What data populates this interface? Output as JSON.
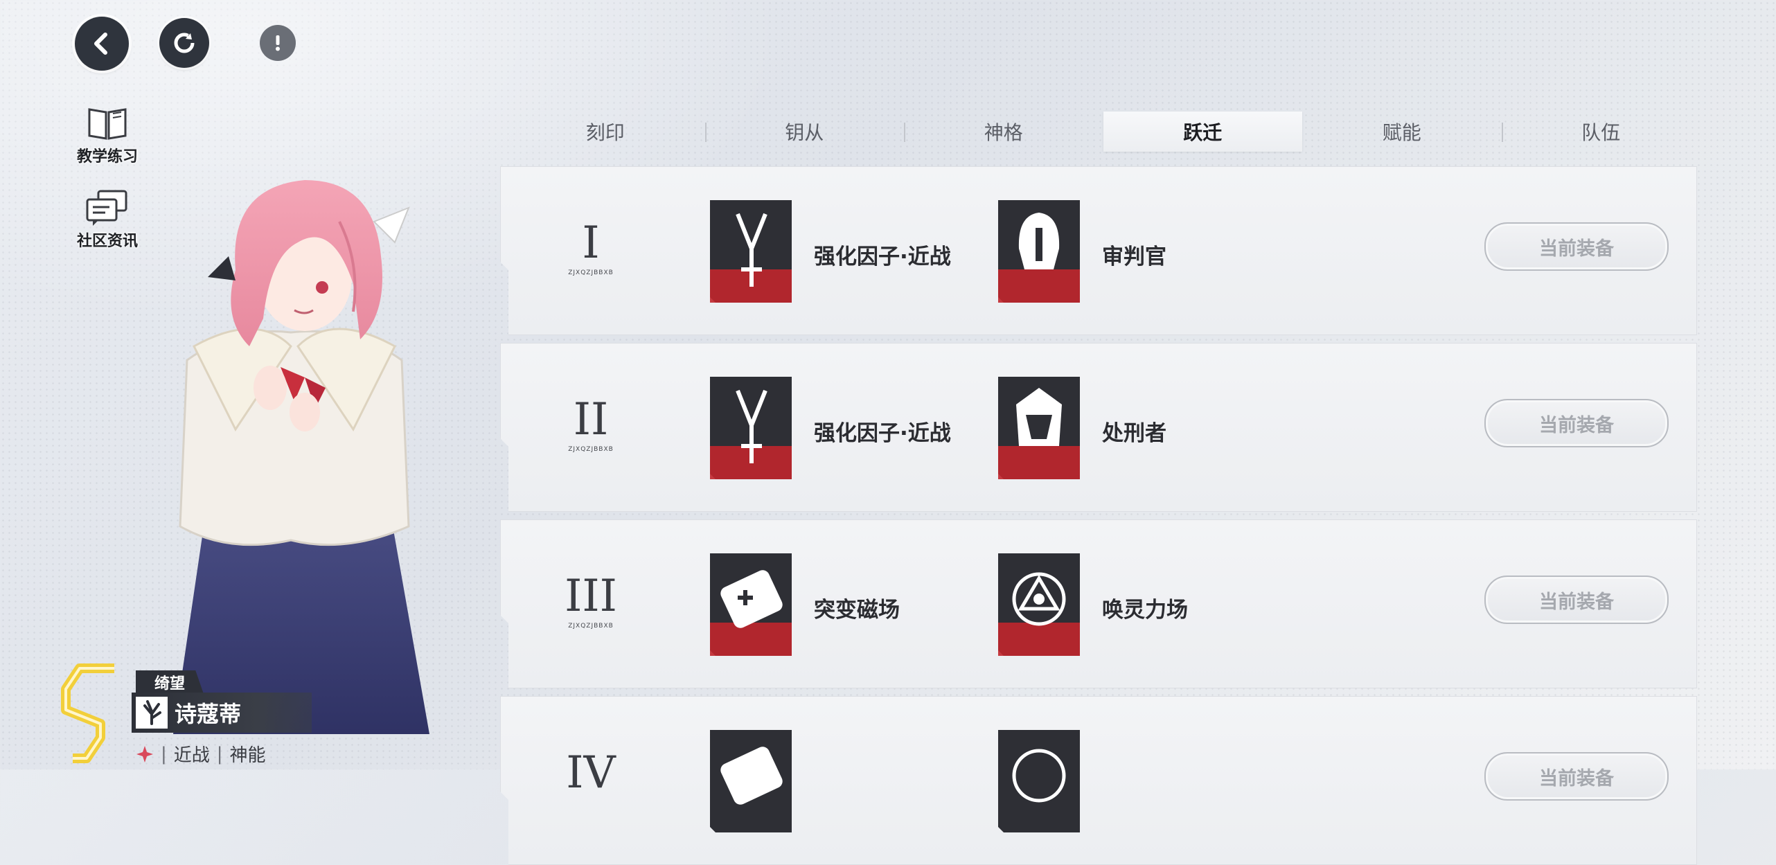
{
  "top_buttons": {
    "back_icon": "chevron-left-icon",
    "sync_icon": "refresh-icon",
    "info_icon": "exclamation-icon"
  },
  "side_links": [
    {
      "label": "教学练习",
      "icon": "book-icon"
    },
    {
      "label": "社区资讯",
      "icon": "chat-icon"
    }
  ],
  "character": {
    "title_tag": "绮望",
    "name": "诗蔻蒂",
    "roles": [
      "近战",
      "神能"
    ],
    "rank": "S"
  },
  "tabs": [
    {
      "label": "刻印",
      "active": false
    },
    {
      "label": "钥从",
      "active": false
    },
    {
      "label": "神格",
      "active": false
    },
    {
      "label": "跃迁",
      "active": true
    },
    {
      "label": "赋能",
      "active": false
    },
    {
      "label": "队伍",
      "active": false
    }
  ],
  "rows": [
    {
      "numeral": "I",
      "tiny": "ZJXQZJBBXB",
      "skill1": "强化因子·近战",
      "skill2": "审判官",
      "button": "当前装备"
    },
    {
      "numeral": "II",
      "tiny": "ZJXQZJBBXB",
      "skill1": "强化因子·近战",
      "skill2": "处刑者",
      "button": "当前装备"
    },
    {
      "numeral": "III",
      "tiny": "ZJXQZJBBXB",
      "skill1": "突变磁场",
      "skill2": "唤灵力场",
      "button": "当前装备"
    },
    {
      "numeral": "IV",
      "tiny": "",
      "skill1": "",
      "skill2": "",
      "button": "当前装备"
    }
  ],
  "colors": {
    "accent_red": "#c0262c",
    "card_dark": "#2e2f35",
    "rank_gold": "#f2cf3a"
  }
}
